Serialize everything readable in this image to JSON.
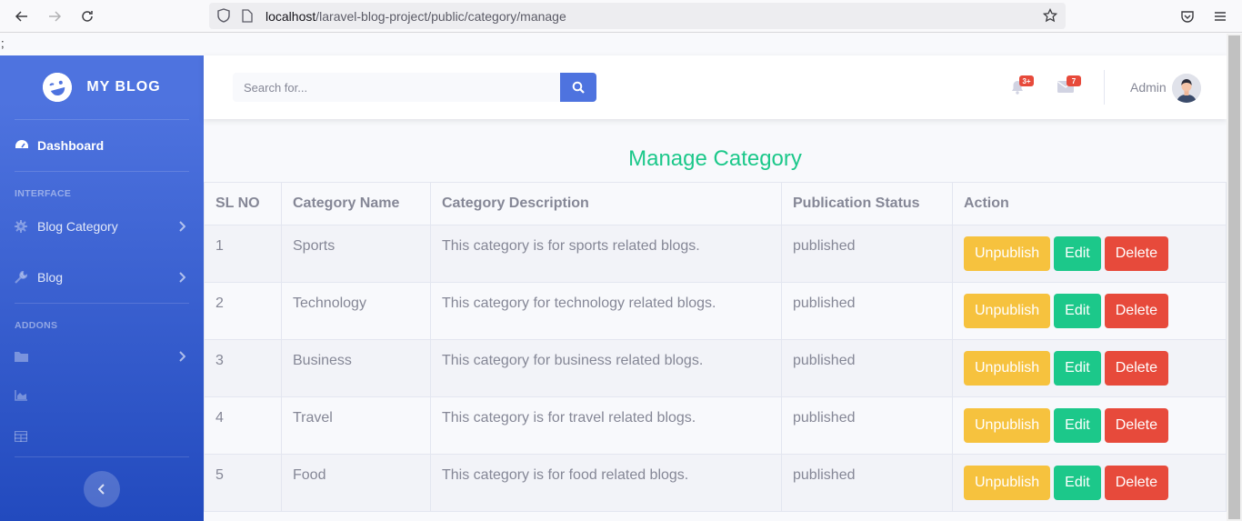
{
  "browser": {
    "url_host": "localhost",
    "url_path": "/laravel-blog-project/public/category/manage"
  },
  "stray_text": ";",
  "sidebar": {
    "brand": "MY BLOG",
    "dashboard": "Dashboard",
    "heading_interface": "INTERFACE",
    "blog_category": "Blog Category",
    "blog": "Blog",
    "heading_addons": "ADDONS"
  },
  "topbar": {
    "search_placeholder": "Search for...",
    "alerts_badge": "3+",
    "messages_badge": "7",
    "user_name": "Admin"
  },
  "main": {
    "title": "Manage Category",
    "columns": [
      "SL NO",
      "Category Name",
      "Category Description",
      "Publication Status",
      "Action"
    ],
    "rows": [
      {
        "sl": "1",
        "name": "Sports",
        "description": "This category is for sports related blogs.",
        "status": "published"
      },
      {
        "sl": "2",
        "name": "Technology",
        "description": "This category for technology related blogs.",
        "status": "published"
      },
      {
        "sl": "3",
        "name": "Business",
        "description": "This category for business related blogs.",
        "status": "published"
      },
      {
        "sl": "4",
        "name": "Travel",
        "description": "This category is for travel related blogs.",
        "status": "published"
      },
      {
        "sl": "5",
        "name": "Food",
        "description": "This category is for food related blogs.",
        "status": "published"
      }
    ],
    "actions": {
      "unpublish": "Unpublish",
      "edit": "Edit",
      "delete": "Delete"
    }
  },
  "colors": {
    "primary": "#4e73df",
    "success": "#1cc88a",
    "warning": "#f6c23e",
    "danger": "#e74a3b"
  }
}
